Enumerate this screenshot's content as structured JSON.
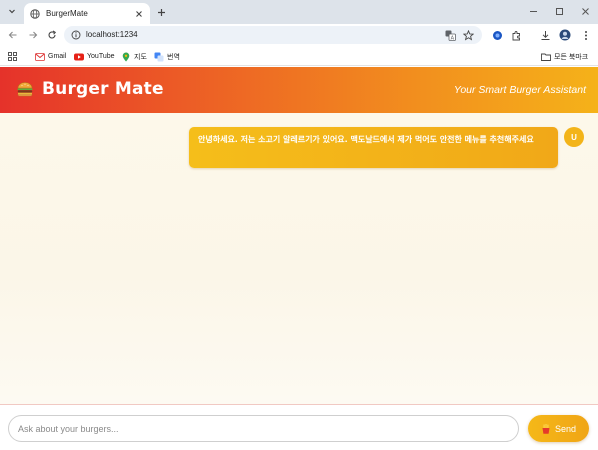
{
  "browser": {
    "tab_title": "BurgerMate",
    "url": "localhost:1234",
    "bookmarks": [
      {
        "label": "Gmail",
        "icon": "gmail-icon"
      },
      {
        "label": "YouTube",
        "icon": "youtube-icon"
      },
      {
        "label": "지도",
        "icon": "maps-icon"
      },
      {
        "label": "번역",
        "icon": "translate-icon"
      }
    ],
    "all_bookmarks_label": "모든 북마크"
  },
  "header": {
    "logo_icon": "burger-icon",
    "app_name": "Burger Mate",
    "tagline": "Your Smart Burger Assistant",
    "gradient_colors": [
      "#e5322a",
      "#f5b219"
    ]
  },
  "chat": {
    "messages": [
      {
        "sender": "user",
        "avatar_initial": "U",
        "text": "안녕하세요. 저는 소고기 알레르기가 있어요. 맥도날드에서 제가 먹어도 안전한 메뉴를 추천해주세요"
      }
    ]
  },
  "composer": {
    "placeholder": "Ask about your burgers...",
    "send_label": "Send",
    "send_icon": "fries-icon",
    "accent": "#f3b419"
  }
}
